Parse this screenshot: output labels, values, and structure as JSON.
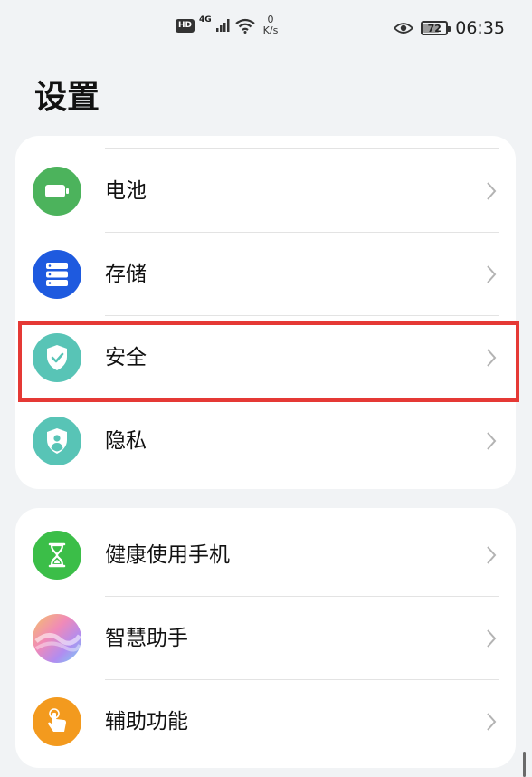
{
  "status_bar": {
    "hd": "HD",
    "network_type": "4G",
    "speed_value": "0",
    "speed_unit": "K/s",
    "battery_level": "72",
    "time": "06:35"
  },
  "page": {
    "title": "设置"
  },
  "groups": [
    {
      "items": [
        {
          "label": "电池",
          "icon": "battery-icon",
          "color": "#4cb35c"
        },
        {
          "label": "存储",
          "icon": "storage-icon",
          "color": "#1e5adf"
        },
        {
          "label": "安全",
          "icon": "security-shield-icon",
          "color": "#58c4b6",
          "highlighted": true
        },
        {
          "label": "隐私",
          "icon": "privacy-shield-icon",
          "color": "#58c4b6"
        }
      ]
    },
    {
      "items": [
        {
          "label": "健康使用手机",
          "icon": "hourglass-icon",
          "color": "#3bbe48"
        },
        {
          "label": "智慧助手",
          "icon": "assistant-icon",
          "color": "#e7a8d8"
        },
        {
          "label": "辅助功能",
          "icon": "accessibility-hand-icon",
          "color": "#f39a1e"
        }
      ]
    }
  ],
  "colors": {
    "background": "#f1f3f5",
    "card": "#ffffff",
    "highlight": "#e53935"
  }
}
